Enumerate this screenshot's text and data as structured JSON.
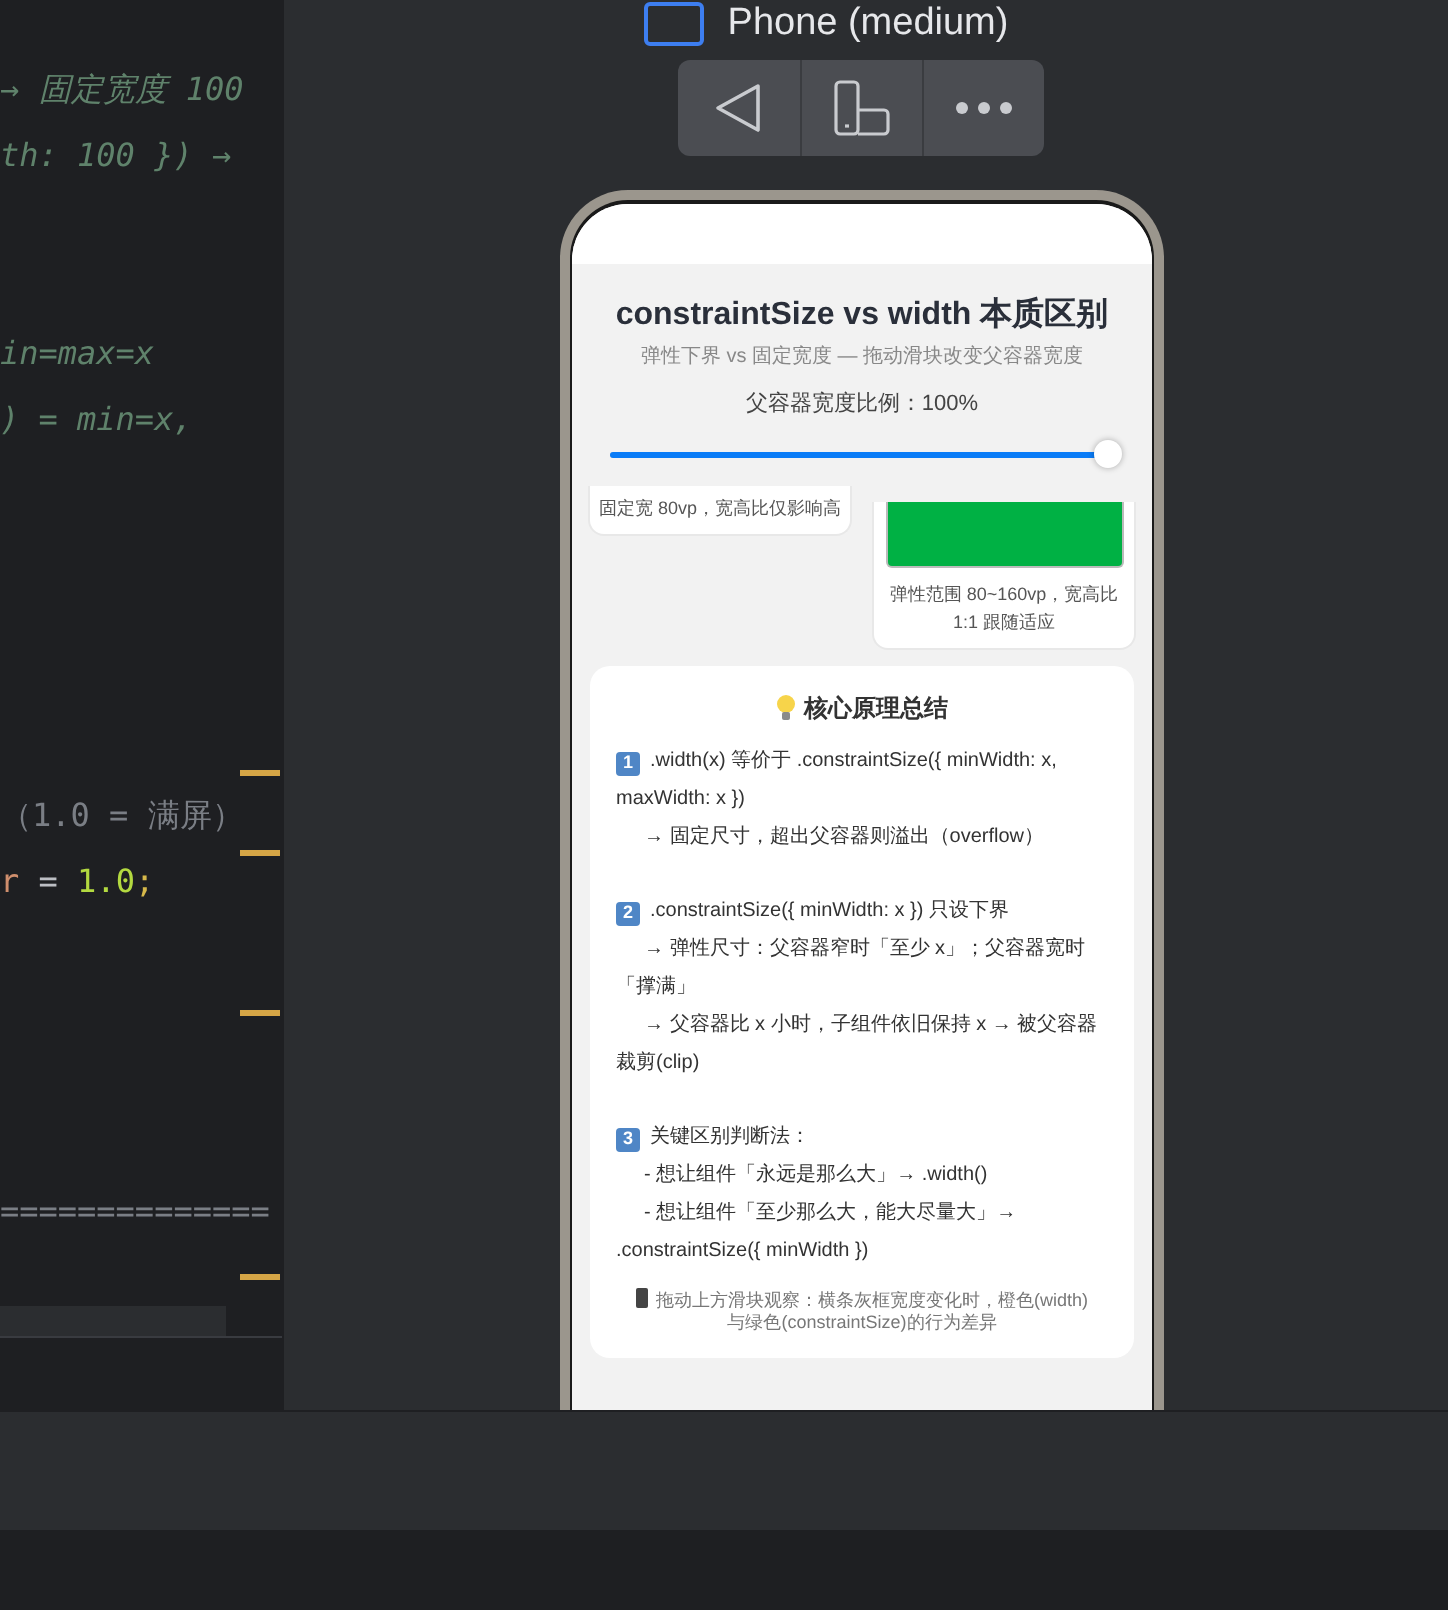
{
  "editor": {
    "lines": [
      {
        "kind": "code",
        "segments": [
          {
            "kind": "comment",
            "text": "→ 固定宽度 100"
          }
        ]
      },
      {
        "kind": "code",
        "segments": [
          {
            "kind": "comment",
            "text": "th: 100 }) →"
          }
        ]
      },
      {
        "kind": "blank"
      },
      {
        "kind": "blank"
      },
      {
        "kind": "code",
        "segments": [
          {
            "kind": "comment",
            "text": "in=max=x"
          }
        ]
      },
      {
        "kind": "code",
        "segments": [
          {
            "kind": "comment",
            "text": ") =  min=x,"
          }
        ]
      },
      {
        "kind": "blank"
      },
      {
        "kind": "blank"
      },
      {
        "kind": "blank"
      },
      {
        "kind": "blank"
      },
      {
        "kind": "blank"
      },
      {
        "kind": "code",
        "segments": [
          {
            "kind": "doc",
            "text": "（1.0 = 满屏）"
          }
        ]
      },
      {
        "kind": "code",
        "segments": [
          {
            "kind": "variable",
            "text": "r"
          },
          {
            "kind": "operator",
            "text": " = "
          },
          {
            "kind": "number",
            "text": "1.0"
          },
          {
            "kind": "punct",
            "text": ";"
          }
        ]
      },
      {
        "kind": "blank"
      },
      {
        "kind": "blank"
      },
      {
        "kind": "blank"
      },
      {
        "kind": "blank"
      },
      {
        "kind": "code",
        "segments": [
          {
            "kind": "doc",
            "text": "=============="
          }
        ]
      }
    ]
  },
  "preview": {
    "device": "Phone (medium)",
    "toolbar": [
      {
        "kind": "back"
      },
      {
        "kind": "rotate"
      },
      {
        "kind": "more"
      }
    ],
    "app": {
      "title": "constraintSize vs width 本质区别",
      "subtitle": "弹性下界 vs 固定宽度 — 拖动滑块改变父容器宽度",
      "slider_label": "父容器宽度比例：100%",
      "slider": {
        "level": 1.0
      },
      "cards": [
        {
          "kind": "fixed",
          "caption": "固定宽 80vp，宽高比仅影响高"
        },
        {
          "kind": "flexible",
          "color": "#00b144",
          "caption": "弹性范围 80~160vp，宽高比 1:1 跟随适应"
        }
      ],
      "summary": {
        "title": "核心原理总结",
        "items": [
          {
            "number": "1",
            "lines": [
              ".width(x) 等价于 .constraintSize({ minWidth: x, maxWidth: x })",
              "→ 固定尺寸，超出父容器则溢出（overflow）"
            ]
          },
          {
            "number": "2",
            "lines": [
              ".constraintSize({ minWidth: x }) 只设下界",
              "→ 弹性尺寸：父容器窄时「至少 x」；父容器宽时「撑满」",
              "→ 父容器比 x 小时，子组件依旧保持 x → 被父容器裁剪(clip)"
            ]
          },
          {
            "number": "3",
            "lines": [
              "关键区别判断法：",
              "- 想让组件「永远是那么大」→ .width()",
              "- 想让组件「至少那么大，能大尽量大」→ .constraintSize({ minWidth })"
            ]
          }
        ],
        "note": "拖动上方滑块观察：横条灰框宽度变化时，橙色(width)与绿色(constraintSize)的行为差异"
      }
    }
  }
}
